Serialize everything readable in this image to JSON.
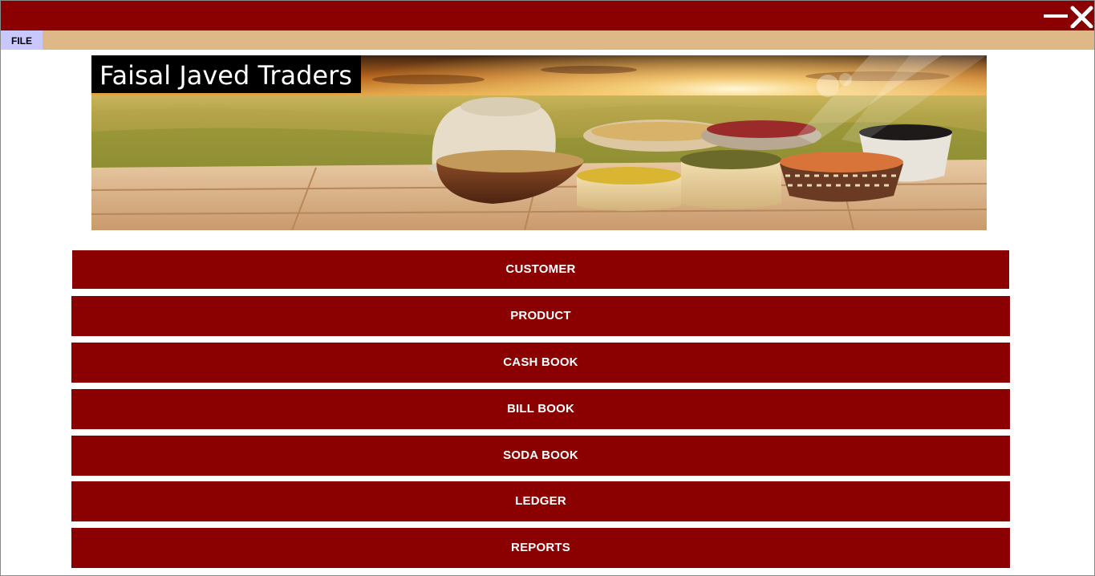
{
  "menu": {
    "file_label": "FILE"
  },
  "banner": {
    "brand_title": "Faisal Javed Traders"
  },
  "nav_buttons": [
    "CUSTOMER",
    "PRODUCT",
    "CASH BOOK",
    "BILL BOOK",
    "SODA BOOK",
    "LEDGER",
    "REPORTS"
  ],
  "icons": {
    "minimize": "minimize-icon",
    "close": "close-icon"
  },
  "colors": {
    "titlebar": "#8b0000",
    "menubar": "#deb887",
    "file_menu": "#c8c8ff",
    "buttons": "#8b0000",
    "button_text": "#ffffff"
  }
}
